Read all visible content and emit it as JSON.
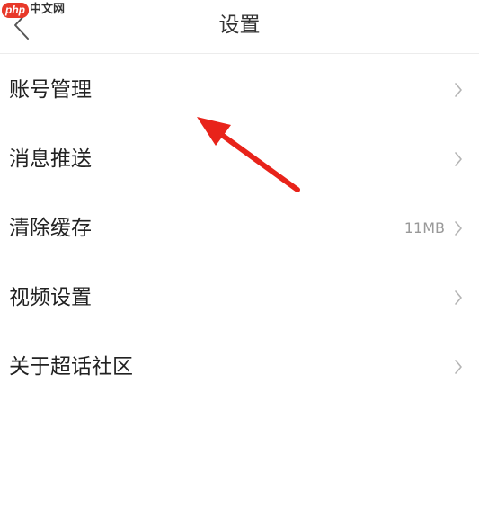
{
  "watermark": {
    "logo": "php",
    "text": "中文网"
  },
  "header": {
    "title": "设置",
    "back_icon": "chevron-left-icon"
  },
  "menu": {
    "items": [
      {
        "label": "账号管理",
        "value": ""
      },
      {
        "label": "消息推送",
        "value": ""
      },
      {
        "label": "清除缓存",
        "value": "11MB"
      },
      {
        "label": "视频设置",
        "value": ""
      },
      {
        "label": "关于超话社区",
        "value": ""
      }
    ],
    "chevron_icon": "chevron-right-icon"
  },
  "colors": {
    "annotation_arrow": "#e8231a",
    "watermark_logo_bg": "#e8392a",
    "chevron": "#b5b5b5",
    "divider": "#ececec",
    "value_text": "#999999"
  }
}
